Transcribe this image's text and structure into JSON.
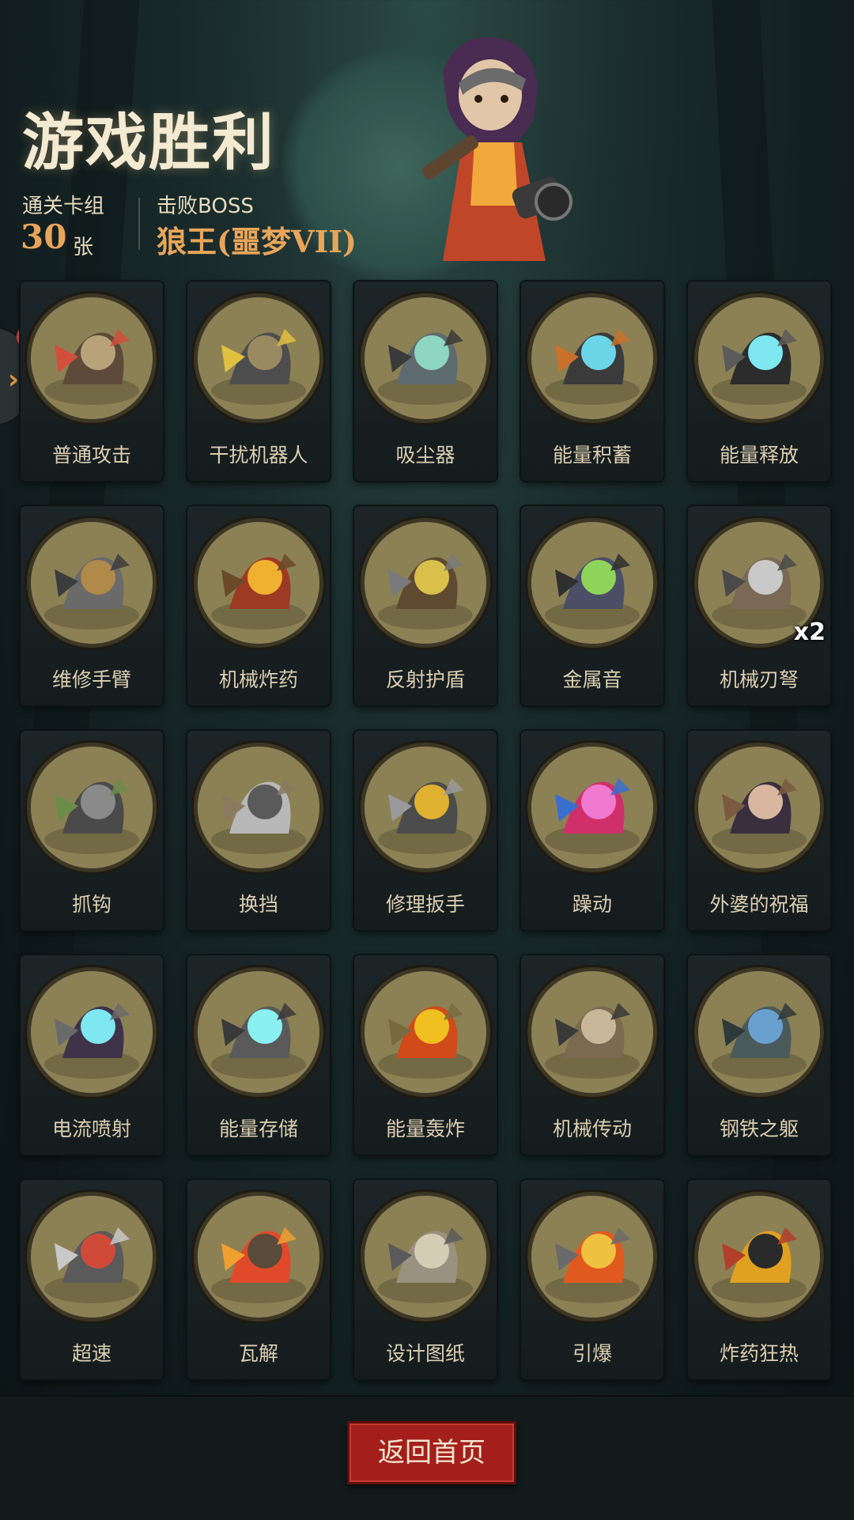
{
  "header": {
    "title": "游戏胜利",
    "deck_label": "通关卡组",
    "deck_count": "30",
    "deck_unit": "张",
    "boss_label": "击败BOSS",
    "boss_name": "狼王(噩梦VII)"
  },
  "cards": [
    {
      "name": "普通攻击",
      "icon": "claw-arm-icon"
    },
    {
      "name": "干扰机器人",
      "icon": "robot-icon"
    },
    {
      "name": "吸尘器",
      "icon": "vacuum-icon"
    },
    {
      "name": "能量积蓄",
      "icon": "energy-dome-icon"
    },
    {
      "name": "能量释放",
      "icon": "lightning-icon"
    },
    {
      "name": "维修手臂",
      "icon": "repair-arm-icon"
    },
    {
      "name": "机械炸药",
      "icon": "dynamite-icon"
    },
    {
      "name": "反射护盾",
      "icon": "shield-icon"
    },
    {
      "name": "金属音",
      "icon": "horn-icon"
    },
    {
      "name": "机械刃弩",
      "icon": "crossbow-icon",
      "badge": "x2"
    },
    {
      "name": "抓钩",
      "icon": "grapple-hook-icon"
    },
    {
      "name": "换挡",
      "icon": "gear-shift-icon"
    },
    {
      "name": "修理扳手",
      "icon": "wrench-icon"
    },
    {
      "name": "躁动",
      "icon": "rage-icon"
    },
    {
      "name": "外婆的祝福",
      "icon": "grandma-icon"
    },
    {
      "name": "电流喷射",
      "icon": "electric-spray-icon"
    },
    {
      "name": "能量存储",
      "icon": "battery-icon"
    },
    {
      "name": "能量轰炸",
      "icon": "fireball-icon"
    },
    {
      "name": "机械传动",
      "icon": "conveyor-icon"
    },
    {
      "name": "钢铁之躯",
      "icon": "iron-body-icon"
    },
    {
      "name": "超速",
      "icon": "unicycle-robot-icon"
    },
    {
      "name": "瓦解",
      "icon": "disintegrate-icon"
    },
    {
      "name": "设计图纸",
      "icon": "blueprint-icon"
    },
    {
      "name": "引爆",
      "icon": "detonate-icon"
    },
    {
      "name": "炸药狂热",
      "icon": "bomb-frenzy-icon"
    }
  ],
  "footer": {
    "home_button": "返回首页"
  },
  "colors": {
    "accent": "#e8a55a",
    "button": "#a41f1c",
    "disc": "#8c8155"
  }
}
